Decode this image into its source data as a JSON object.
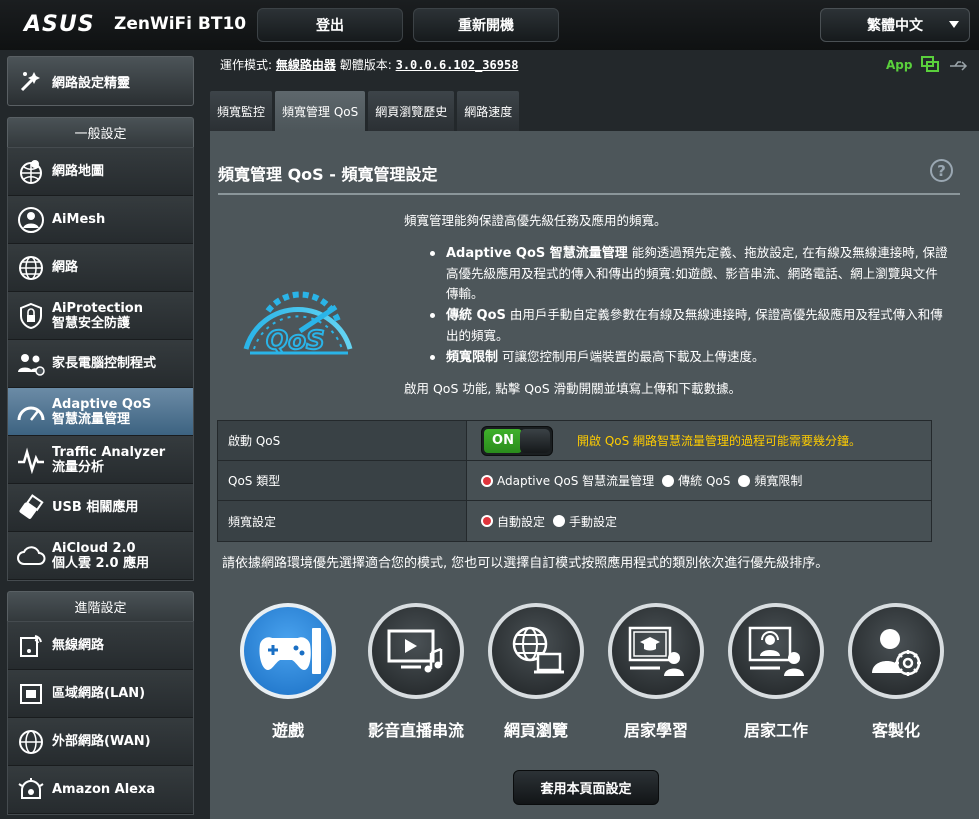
{
  "header": {
    "brand": "ASUS",
    "model": "ZenWiFi BT10",
    "logout_label": "登出",
    "reboot_label": "重新開機",
    "language": "繁體中文"
  },
  "status": {
    "opmode_label": "運作模式:",
    "opmode_value": "無線路由器",
    "firmware_label": "韌體版本:",
    "firmware_value": "3.0.0.6.102_36958",
    "app_label": "App"
  },
  "sidebar": {
    "wizard_label": "網路設定精靈",
    "general_head": "一般設定",
    "general_items": [
      {
        "label": "網路地圖",
        "label2": ""
      },
      {
        "label": "AiMesh",
        "label2": ""
      },
      {
        "label": "網路",
        "label2": ""
      },
      {
        "label": "AiProtection",
        "label2": "智慧安全防護"
      },
      {
        "label": "家長電腦控制程式",
        "label2": ""
      },
      {
        "label": "Adaptive QoS",
        "label2": "智慧流量管理"
      },
      {
        "label": "Traffic Analyzer",
        "label2": "流量分析"
      },
      {
        "label": "USB 相關應用",
        "label2": ""
      },
      {
        "label": "AiCloud 2.0",
        "label2": "個人雲 2.0 應用"
      }
    ],
    "advanced_head": "進階設定",
    "advanced_items": [
      {
        "label": "無線網路"
      },
      {
        "label": "區域網路(LAN)"
      },
      {
        "label": "外部網路(WAN)"
      },
      {
        "label": "Amazon Alexa"
      }
    ]
  },
  "tabs": [
    "頻寬監控",
    "頻寬管理 QoS",
    "網頁瀏覽歷史",
    "網路速度"
  ],
  "main": {
    "title": "頻寬管理 QoS - 頻寬管理設定",
    "help": "?",
    "logo_text": "QoS",
    "desc": "頻寬管理能夠保證高優先級任務及應用的頻寬。",
    "bullets": [
      {
        "bold": "Adaptive QoS 智慧流量管理",
        "text": " 能夠透過預先定義、拖放設定, 在有線及無線連接時, 保證高優先級應用及程式的傳入和傳出的頻寬:如遊戲、影音串流、網路電話、網上瀏覽與文件傳輸。"
      },
      {
        "bold": "傳統 QoS",
        "text": " 由用戶手動自定義參數在有線及無線連接時, 保證高優先級應用及程式傳入和傳出的頻寬。"
      },
      {
        "bold": "頻寬限制",
        "text": " 可讓您控制用戶端裝置的最高下載及上傳速度。"
      }
    ],
    "enable_note": "啟用 QoS 功能, 點擊 QoS 滑動開關並填寫上傳和下載數據。",
    "table": {
      "enable_label": "啟動 QoS",
      "toggle_on": "ON",
      "enable_warn": "開啟 QoS 網路智慧流量管理的過程可能需要幾分鐘。",
      "type_label": "QoS 類型",
      "type_options": [
        "Adaptive QoS 智慧流量管理",
        "傳統 QoS",
        "頻寬限制"
      ],
      "bw_label": "頻寬設定",
      "bw_options": [
        "自動設定",
        "手動設定"
      ]
    },
    "mode_note": "請依據網路環境優先選擇適合您的模式, 您也可以選擇自訂模式按照應用程式的類別依次進行優先級排序。",
    "modes": [
      "遊戲",
      "影音直播串流",
      "網頁瀏覽",
      "居家學習",
      "居家工作",
      "客製化"
    ],
    "apply_label": "套用本頁面設定"
  },
  "colors": {
    "accent_blue": "#1a6fc4",
    "toggle_green": "#3fb02b",
    "warn_yellow": "#ffcc00",
    "app_green": "#5ad03c"
  }
}
